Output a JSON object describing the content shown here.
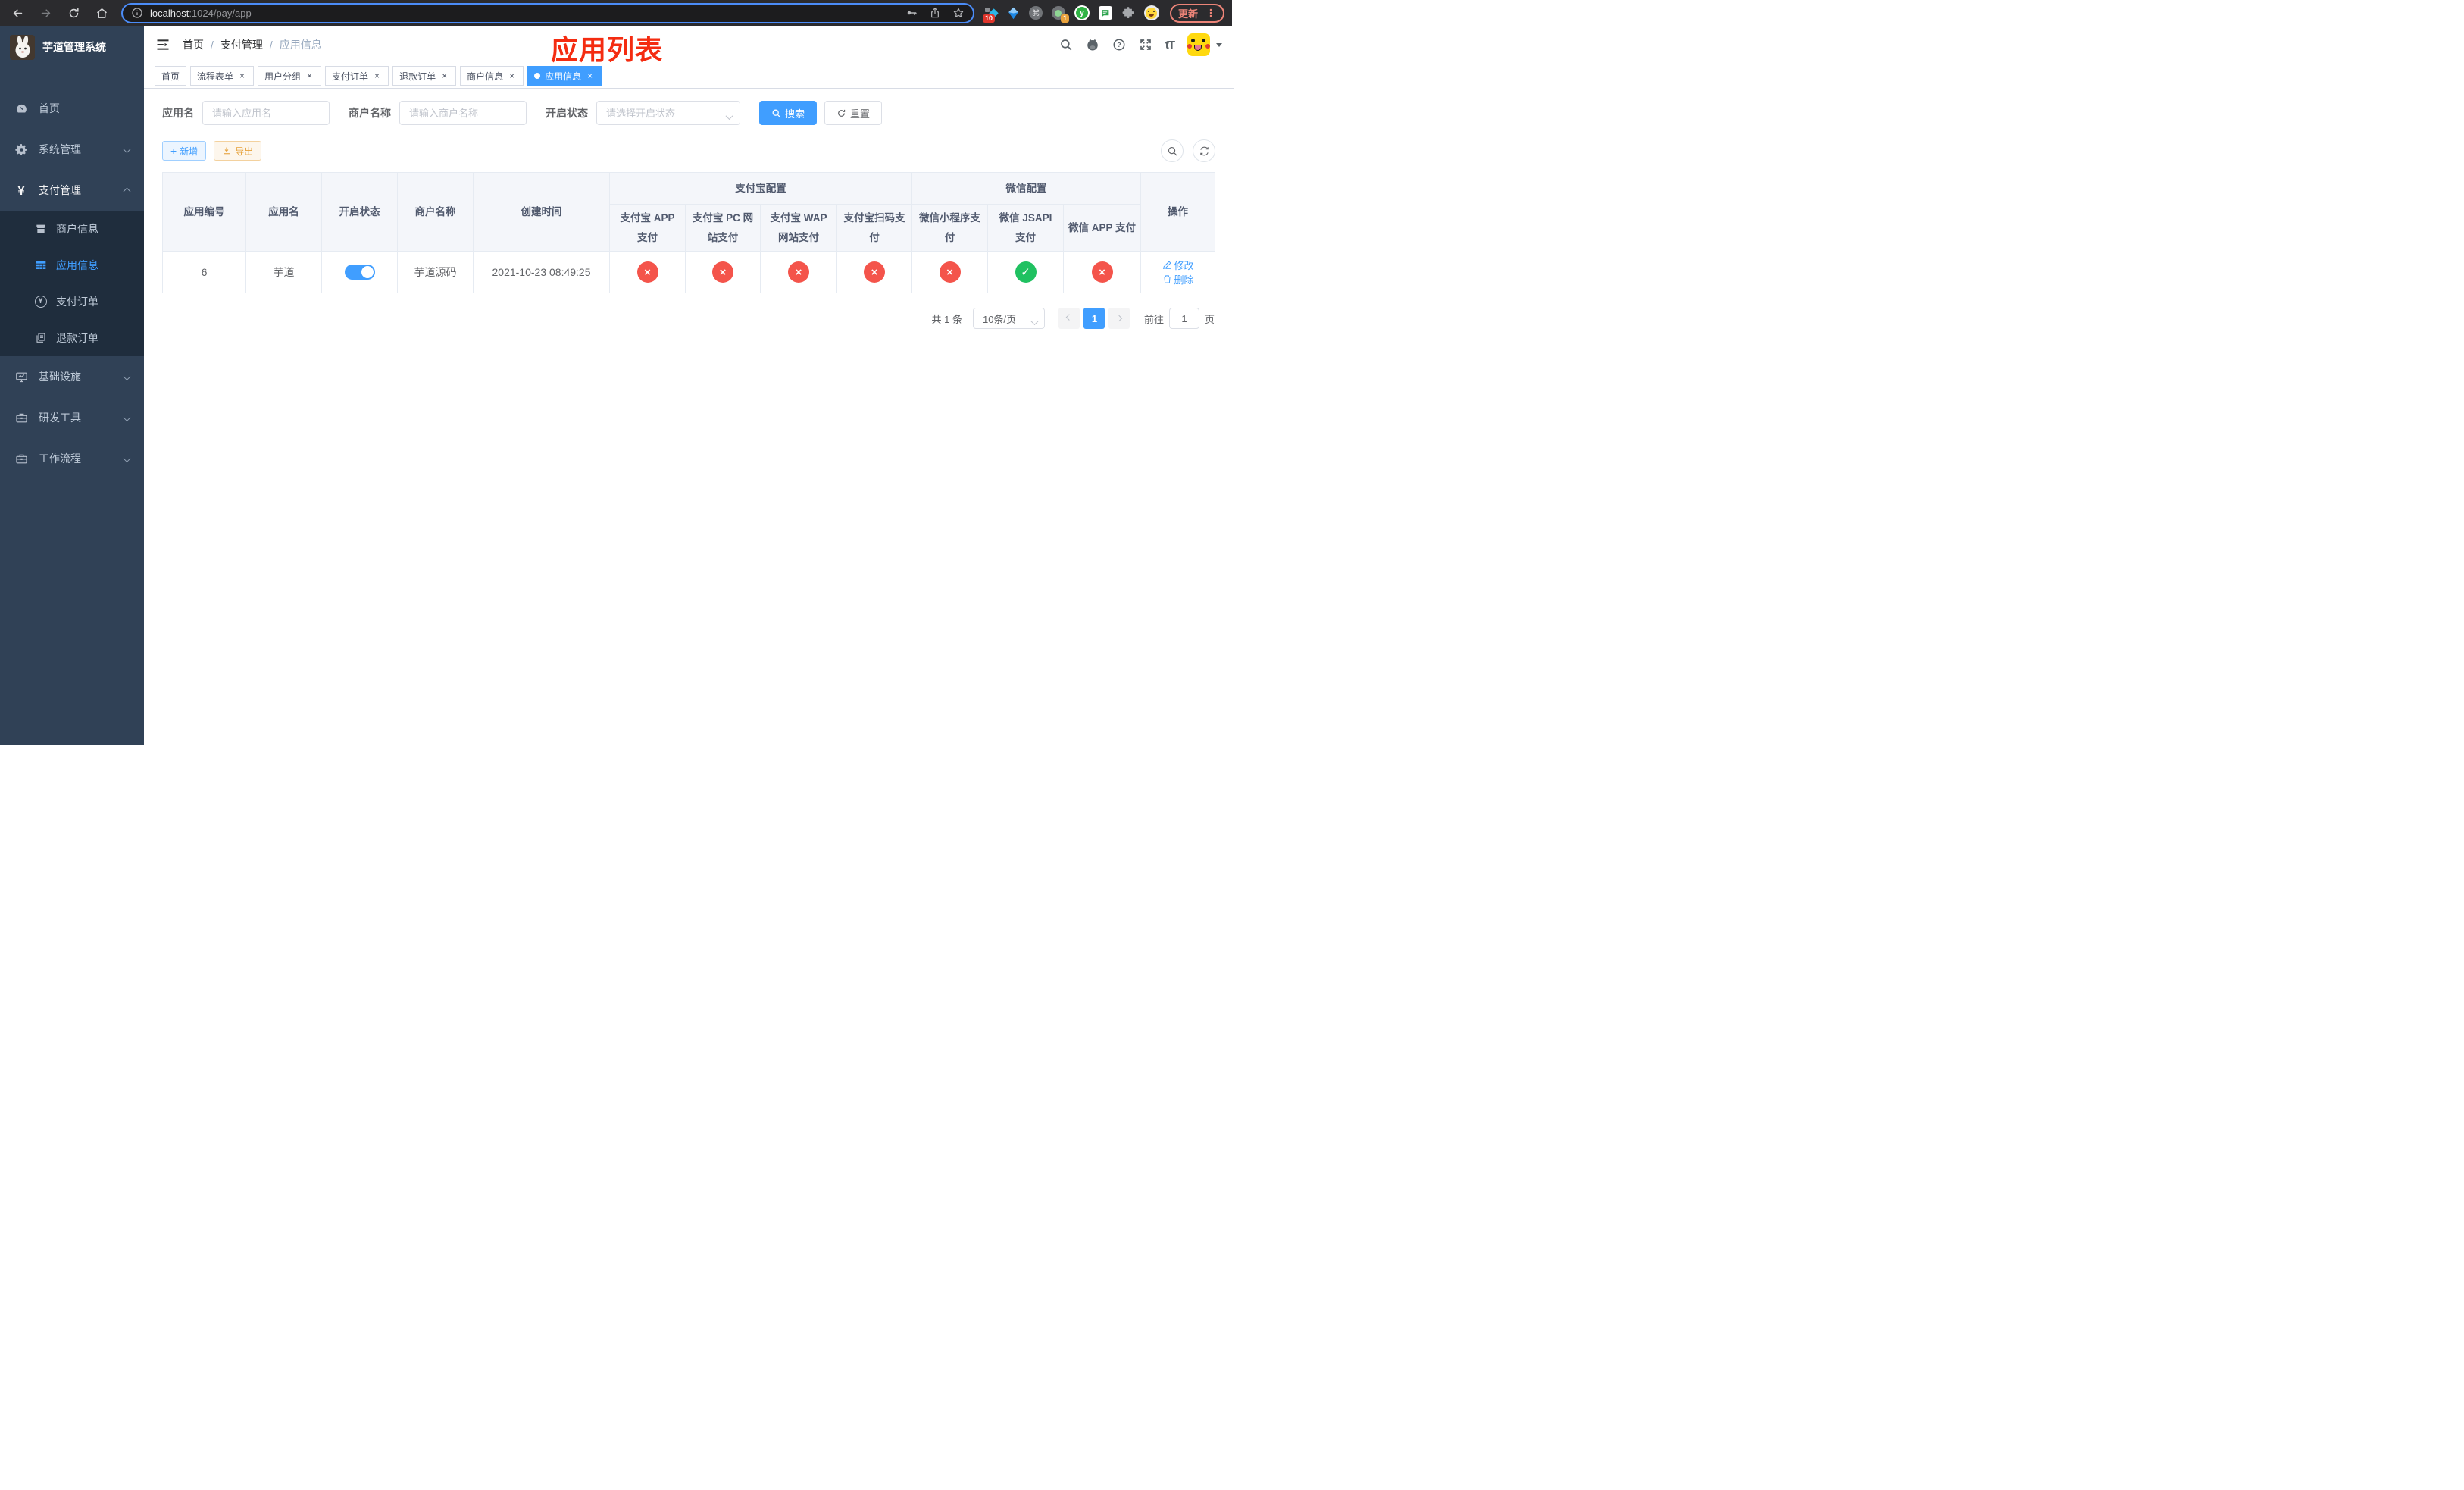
{
  "browser": {
    "url_host": "localhost",
    "url_path": ":1024/pay/app",
    "update_label": "更新",
    "ext_badges": {
      "first": "10",
      "second": "1"
    }
  },
  "icons": {
    "question": "?",
    "font_size": "tT",
    "command": "⌘",
    "dots": "⋮",
    "plus": "+",
    "yen": "¥",
    "letter_y": "y",
    "cross": "×",
    "separator": "/"
  },
  "sidebar": {
    "title": "芋道管理系统",
    "items": [
      {
        "label": "首页"
      },
      {
        "label": "系统管理"
      },
      {
        "label": "支付管理"
      },
      {
        "label": "商户信息"
      },
      {
        "label": "应用信息"
      },
      {
        "label": "支付订单"
      },
      {
        "label": "退款订单"
      },
      {
        "label": "基础设施"
      },
      {
        "label": "研发工具"
      },
      {
        "label": "工作流程"
      }
    ]
  },
  "navbar": {
    "breadcrumb": {
      "home": "首页",
      "section": "支付管理",
      "current": "应用信息"
    }
  },
  "annotation": {
    "text": "应用列表"
  },
  "tabs": {
    "home": "首页",
    "t1": "流程表单",
    "t2": "用户分组",
    "t3": "支付订单",
    "t4": "退款订单",
    "t5": "商户信息",
    "active": "应用信息"
  },
  "filters": {
    "app_name_label": "应用名",
    "app_name_placeholder": "请输入应用名",
    "merchant_label": "商户名称",
    "merchant_placeholder": "请输入商户名称",
    "status_label": "开启状态",
    "status_placeholder": "请选择开启状态",
    "search_label": "搜索",
    "reset_label": "重置"
  },
  "toolbar": {
    "add_label": "新增",
    "export_label": "导出"
  },
  "table": {
    "headers": {
      "app_id": "应用编号",
      "app_name": "应用名",
      "status": "开启状态",
      "merchant": "商户名称",
      "created": "创建时间",
      "alipay_group": "支付宝配置",
      "wechat_group": "微信配置",
      "actions": "操作",
      "alipay_app": "支付宝 APP 支付",
      "alipay_pc": "支付宝 PC 网站支付",
      "alipay_wap": "支付宝 WAP 网站支付",
      "alipay_scan": "支付宝扫码支付",
      "wx_lite": "微信小程序支付",
      "wx_jsapi": "微信 JSAPI 支付",
      "wx_app": "微信 APP 支付"
    },
    "row": {
      "app_id": "6",
      "app_name": "芋道",
      "status_on": true,
      "merchant": "芋道源码",
      "created": "2021-10-23 08:49:25",
      "channels": {
        "alipay_app": false,
        "alipay_pc": false,
        "alipay_wap": false,
        "alipay_scan": false,
        "wx_lite": false,
        "wx_jsapi": true,
        "wx_app": false
      },
      "edit_label": "修改",
      "delete_label": "删除"
    },
    "glyphs": {
      "enabled": "✓",
      "disabled": "×"
    }
  },
  "pagination": {
    "total": "共 1 条",
    "page_size": "10条/页",
    "current_page": "1",
    "goto_label": "前往",
    "goto_value": "1",
    "goto_unit": "页"
  }
}
